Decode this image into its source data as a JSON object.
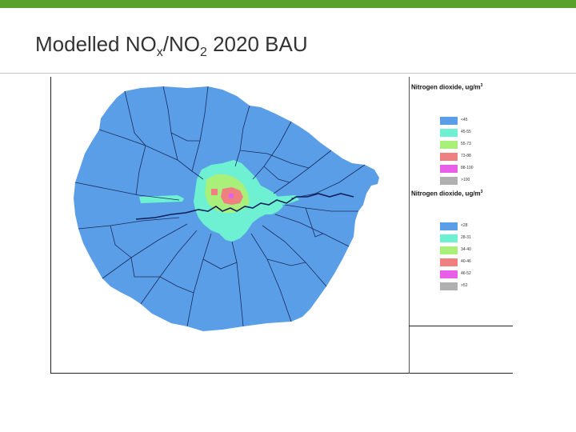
{
  "slide": {
    "accent_color": "#5aa02c",
    "title_main": "Modelled NO",
    "title_sub1": "x",
    "title_mid": "/NO",
    "title_sub2": "2",
    "title_end": " 2020 BAU"
  },
  "legends": [
    {
      "title": "Nitrogen dioxide, ug/m",
      "title_sup": "3",
      "items": [
        {
          "label": "<45",
          "color": "#5a9ee8"
        },
        {
          "label": "45-55",
          "color": "#6ef0d2"
        },
        {
          "label": "55-73",
          "color": "#a8f07a"
        },
        {
          "label": "73-88",
          "color": "#f08080"
        },
        {
          "label": "88-100",
          "color": "#e860e8"
        },
        {
          "label": ">100",
          "color": "#b0b0b0"
        }
      ]
    },
    {
      "title": "Nitrogen dioxide, ug/m",
      "title_sup": "3",
      "items": [
        {
          "label": "<28",
          "color": "#5a9ee8"
        },
        {
          "label": "28-31",
          "color": "#6ef0d2"
        },
        {
          "label": "34-40",
          "color": "#a8f07a"
        },
        {
          "label": "40-46",
          "color": "#f08080"
        },
        {
          "label": "46-52",
          "color": "#e860e8"
        },
        {
          "label": ">52",
          "color": "#b0b0b0"
        }
      ]
    }
  ],
  "map": {
    "zone_colors": {
      "background": "#5a9ee8",
      "band1": "#6ef0d2",
      "band2": "#a8f07a",
      "band3": "#f08080",
      "band4": "#e860e8",
      "boundary": "#1a2a5a",
      "river": "#10205a"
    }
  }
}
